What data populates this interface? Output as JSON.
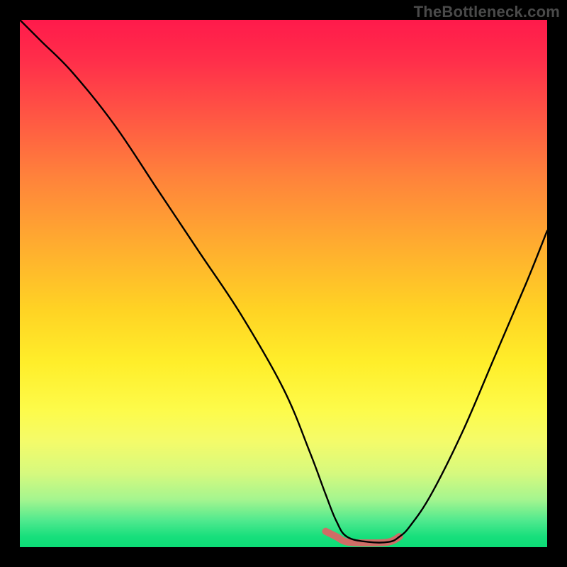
{
  "watermark": "TheBottleneck.com",
  "chart_data": {
    "type": "line",
    "title": "",
    "xlabel": "",
    "ylabel": "",
    "xlim": [
      0,
      100
    ],
    "ylim": [
      0,
      100
    ],
    "grid": false,
    "series": [
      {
        "name": "bottleneck-curve",
        "x": [
          0,
          4,
          10,
          18,
          26,
          34,
          42,
          50,
          55,
          58,
          60,
          62,
          66,
          70,
          72,
          74,
          78,
          84,
          90,
          96,
          100
        ],
        "values": [
          100,
          96,
          90,
          80,
          68,
          56,
          44,
          30,
          18,
          10,
          5,
          2,
          1,
          1,
          2,
          4,
          10,
          22,
          36,
          50,
          60
        ]
      }
    ],
    "accent_segment": {
      "name": "highlighted-min-region",
      "x": [
        58,
        60,
        62,
        66,
        70,
        72
      ],
      "values": [
        3,
        2,
        1,
        0.8,
        1,
        2
      ]
    },
    "background_gradient": {
      "top": "#ff1a4b",
      "mid": "#ffd324",
      "bottom": "#0cdc76"
    }
  }
}
